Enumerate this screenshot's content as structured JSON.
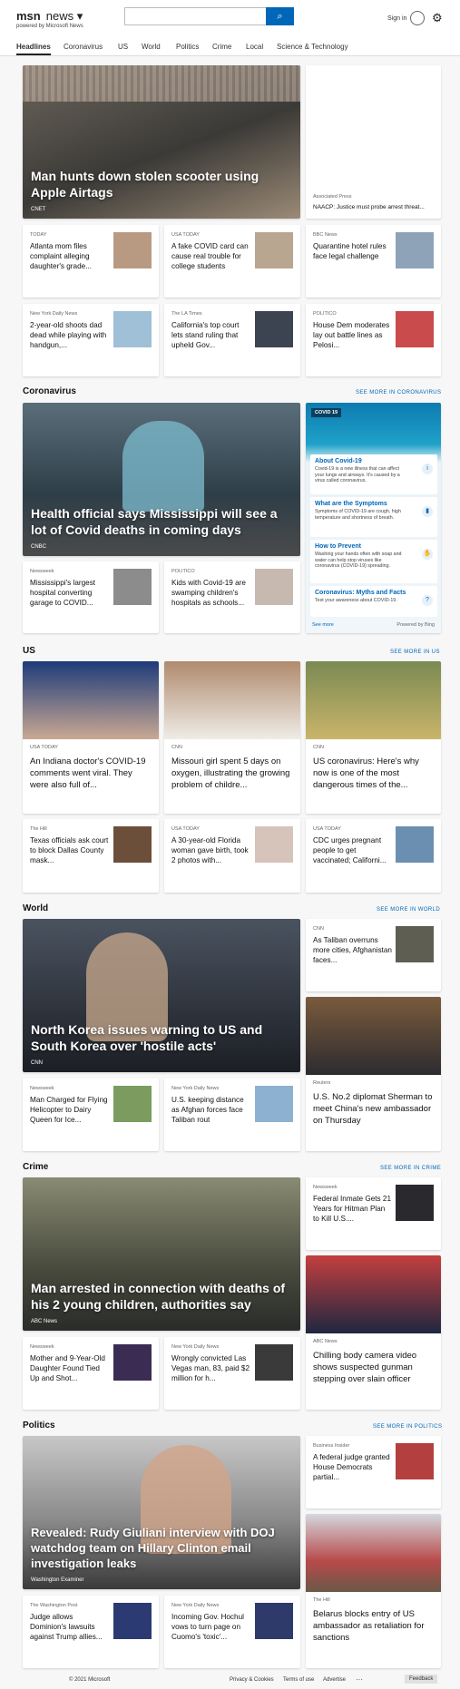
{
  "header": {
    "brand": "msn",
    "news": "news",
    "powered": "powered by Microsoft News",
    "signin": "Sign in"
  },
  "nav": [
    "Headlines",
    "Coronavirus",
    "US",
    "World",
    "Politics",
    "Crime",
    "Local",
    "Science & Technology"
  ],
  "top": {
    "hero": {
      "title": "Man hunts down stolen scooter using Apple Airtags",
      "source": "CNET"
    },
    "ad": {
      "source": "Associated Press",
      "title": "NAACP: Justice must probe arrest threat..."
    },
    "cards": [
      {
        "source": "TODAY",
        "title": "Atlanta mom files complaint alleging daughter's grade..."
      },
      {
        "source": "USA TODAY",
        "title": "A fake COVID card can cause real trouble for college students"
      },
      {
        "source": "BBC News",
        "title": "Quarantine hotel rules face legal challenge"
      },
      {
        "source": "New York Daily News",
        "title": "2-year-old shoots dad dead while playing with handgun,..."
      },
      {
        "source": "The LA Times",
        "title": "California's top court lets stand ruling that upheld Gov..."
      },
      {
        "source": "POLITICO",
        "title": "House Dem moderates lay out battle lines as Pelosi..."
      }
    ]
  },
  "coronavirus": {
    "label": "Coronavirus",
    "more": "SEE MORE IN CORONAVIRUS",
    "hero": {
      "title": "Health official says Mississippi will see a lot of Covid deaths in coming days",
      "source": "CNBC"
    },
    "cards": [
      {
        "source": "Newsweek",
        "title": "Mississippi's largest hospital converting garage to COVID..."
      },
      {
        "source": "POLITICO",
        "title": "Kids with Covid-19 are swamping children's hospitals as schools..."
      }
    ],
    "panel": {
      "badge": "COVID 19",
      "see_more": "See more",
      "powered": "Powered by Bing",
      "items": [
        {
          "title": "About Covid-19",
          "text": "Covid-19 is a new illness that can affect your lungs and airways. It's caused by a virus called coronavirus."
        },
        {
          "title": "What are the Symptoms",
          "text": "Symptoms of COVID-19 are cough, high temperature and shortness of breath."
        },
        {
          "title": "How to Prevent",
          "text": "Washing your hands often with soap and water can help stop viruses like coronavirus (COVID-19) spreading."
        },
        {
          "title": "Coronavirus: Myths and Facts",
          "text": "Test your awareness about COVID-19."
        }
      ]
    }
  },
  "us": {
    "label": "US",
    "more": "SEE MORE IN US",
    "big": [
      {
        "source": "USA TODAY",
        "title": "An Indiana doctor's COVID-19 comments went viral. They were also full of..."
      },
      {
        "source": "CNN",
        "title": "Missouri girl spent 5 days on oxygen, illustrating the growing problem of childre..."
      },
      {
        "source": "CNN",
        "title": "US coronavirus: Here's why now is one of the most dangerous times of the..."
      }
    ],
    "cards": [
      {
        "source": "The Hill",
        "title": "Texas officials ask court to block Dallas County mask..."
      },
      {
        "source": "USA TODAY",
        "title": "A 30-year-old Florida woman gave birth, took 2 photos with..."
      },
      {
        "source": "USA TODAY",
        "title": "CDC urges pregnant people to get vaccinated; Californi..."
      }
    ]
  },
  "world": {
    "label": "World",
    "more": "SEE MORE IN WORLD",
    "hero": {
      "title": "North Korea issues warning to US and South Korea over 'hostile acts'",
      "source": "CNN"
    },
    "side": {
      "source": "CNN",
      "title": "As Taliban overruns more cities, Afghanistan faces..."
    },
    "big": {
      "source": "Reuters",
      "title": "U.S. No.2 diplomat Sherman to meet China's new ambassador on Thursday"
    },
    "cards": [
      {
        "source": "Newsweek",
        "title": "Man Charged for Flying Helicopter to Dairy Queen for Ice..."
      },
      {
        "source": "New York Daily News",
        "title": "U.S. keeping distance as Afghan forces face Taliban rout"
      }
    ]
  },
  "crime": {
    "label": "Crime",
    "more": "SEE MORE IN CRIME",
    "hero": {
      "title": "Man arrested in connection with deaths of his 2 young children, authorities say",
      "source": "ABC News"
    },
    "side": {
      "source": "Newsweek",
      "title": "Federal Inmate Gets 21 Years for Hitman Plan to Kill U.S...."
    },
    "big": {
      "source": "ABC News",
      "title": "Chilling body camera video shows suspected gunman stepping over slain officer"
    },
    "cards": [
      {
        "source": "Newsweek",
        "title": "Mother and 9-Year-Old Daughter Found Tied Up and Shot..."
      },
      {
        "source": "New York Daily News",
        "title": "Wrongly convicted Las Vegas man, 83, paid $2 million for h..."
      }
    ]
  },
  "politics": {
    "label": "Politics",
    "more": "SEE MORE IN POLITICS",
    "hero": {
      "title": "Revealed: Rudy Giuliani interview with DOJ watchdog team on Hillary Clinton email investigation leaks",
      "source": "Washington Examiner"
    },
    "side": {
      "source": "Business Insider",
      "title": "A federal judge granted House Democrats partial..."
    },
    "big": {
      "source": "The Hill",
      "title": "Belarus blocks entry of US ambassador as retaliation for sanctions"
    },
    "cards": [
      {
        "source": "The Washington Post",
        "title": "Judge allows Dominion's lawsuits against Trump allies..."
      },
      {
        "source": "New York Daily News",
        "title": "Incoming Gov. Hochul vows to turn page on Cuomo's 'toxic'..."
      }
    ]
  },
  "footer": {
    "copyright": "© 2021 Microsoft",
    "privacy": "Privacy & Cookies",
    "terms": "Terms of use",
    "advertise": "Advertise",
    "feedback": "Feedback"
  }
}
